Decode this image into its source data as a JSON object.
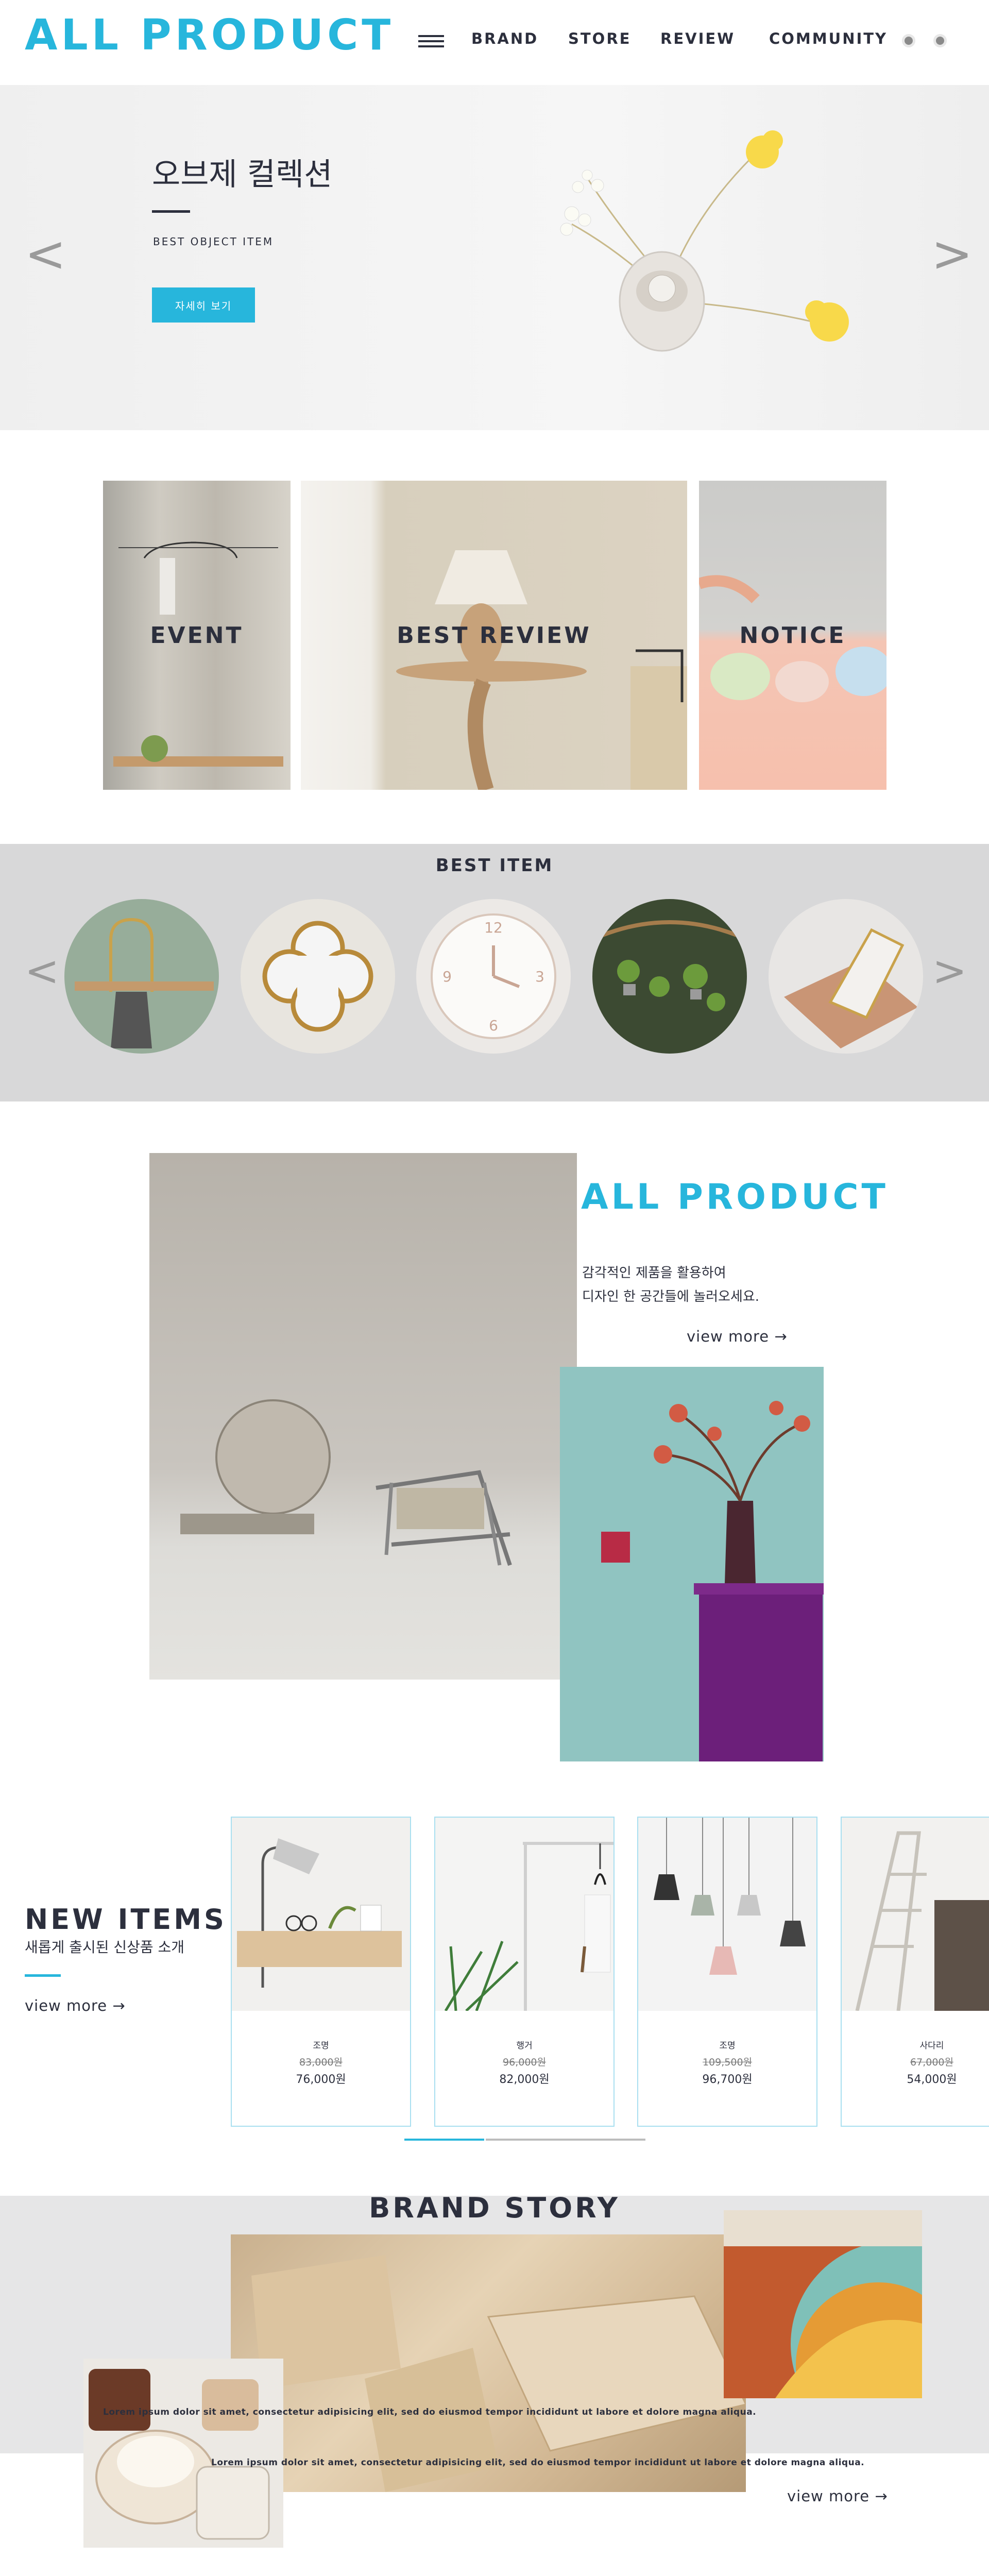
{
  "header": {
    "logo": "ALL PRODUCT",
    "nav": [
      "BRAND",
      "STORE",
      "REVIEW",
      "COMMUNITY"
    ]
  },
  "hero": {
    "title": "오브제 컬렉션",
    "subtitle": "BEST OBJECT ITEM",
    "button": "자세히 보기",
    "prev": "<",
    "next": ">"
  },
  "tiles": [
    "EVENT",
    "BEST REVIEW",
    "NOTICE"
  ],
  "best_item": {
    "title": "BEST ITEM",
    "prev": "<",
    "next": ">"
  },
  "all_product": {
    "title": "ALL PRODUCT",
    "line1": "감각적인 제품을 활용하여",
    "line2": "디자인 한 공간들에 놀러오세요.",
    "view_more": "view more →"
  },
  "new_items": {
    "title": "NEW ITEMS",
    "subtitle": "새롭게 출시된 신상품 소개",
    "view_more": "view more →",
    "products": [
      {
        "name": "조명",
        "old_price": "83,000원",
        "price": "76,000원"
      },
      {
        "name": "행거",
        "old_price": "96,000원",
        "price": "82,000원"
      },
      {
        "name": "조명",
        "old_price": "109,500원",
        "price": "96,700원"
      },
      {
        "name": "사다리",
        "old_price": "67,000원",
        "price": "54,000원"
      }
    ]
  },
  "brand_story": {
    "title": "BRAND STORY",
    "lorem1": "Lorem ipsum dolor sit amet, consectetur adipisicing elit, sed do eiusmod tempor incididunt ut labore et dolore magna aliqua.",
    "lorem2": "Lorem ipsum dolor sit amet, consectetur adipisicing elit, sed do eiusmod tempor incididunt ut labore et dolore magna aliqua.",
    "view_more": "view more →"
  },
  "colors": {
    "accent": "#27b6dc",
    "text": "#2c2f3d",
    "band": "#d8d8d9"
  }
}
